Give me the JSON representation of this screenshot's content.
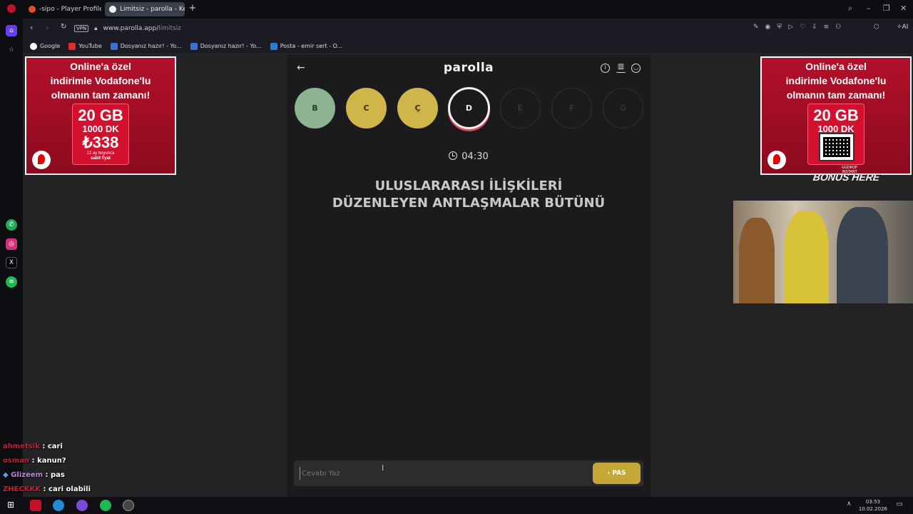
{
  "browser": {
    "tabs": [
      {
        "label": "-sipo - Player Profile - FAC"
      },
      {
        "label": "Limitsiz - parolla - Kelime"
      }
    ],
    "url_prefix": "www.parolla.app/",
    "url_path": "limitsiz",
    "vpn_badge": "VPN",
    "ai_label": "AI",
    "bookmarks": [
      {
        "label": "Google"
      },
      {
        "label": "YouTube"
      },
      {
        "label": "Dosyanız hazır! - Yo..."
      },
      {
        "label": "Dosyanız hazır! - Yo..."
      },
      {
        "label": "Posta - emir sert - O..."
      }
    ]
  },
  "ad": {
    "headline_1": "Online'a özel",
    "headline_2": "indirimle Vodafone'lu",
    "headline_3": "olmanın tam zamanı!",
    "gb": "20 GB",
    "dk": "1000 DK",
    "price": "₺338",
    "period": "12 ay boyunca",
    "fixed": "sabit fiyat"
  },
  "game": {
    "logo": "parolla",
    "letters": [
      {
        "letter": "B",
        "state": "correct"
      },
      {
        "letter": "C",
        "state": "passed"
      },
      {
        "letter": "Ç",
        "state": "passed"
      },
      {
        "letter": "D",
        "state": "active"
      },
      {
        "letter": "E",
        "state": "empty"
      },
      {
        "letter": "F",
        "state": "empty"
      },
      {
        "letter": "G",
        "state": "empty"
      }
    ],
    "timer": "04:30",
    "question_line1": "ULUSLARARASI İLİŞKİLERİ",
    "question_line2": "DÜZENLEYEN ANTLAŞMALAR BÜTÜNÜ",
    "answer_placeholder": "Cevabı Yaz",
    "pas_label": "PAS",
    "colors": {
      "correct": "#8db391",
      "passed": "#cfb54a",
      "active_ring": "#d94b5a"
    }
  },
  "overlay": {
    "qr_brand": "GGDROP",
    "qr_sub": "INSTANT",
    "bonus": "BONUS HERE"
  },
  "chat": [
    {
      "user": "ahmetsik",
      "message": ": cari"
    },
    {
      "user": "osman",
      "message": ": kanun?"
    },
    {
      "user": "Glizeem",
      "message": ": pas"
    },
    {
      "user": "ZHECKKK",
      "message": ": cari olabili"
    }
  ],
  "taskbar": {
    "time": "03:53",
    "date": "10.02.2026"
  }
}
